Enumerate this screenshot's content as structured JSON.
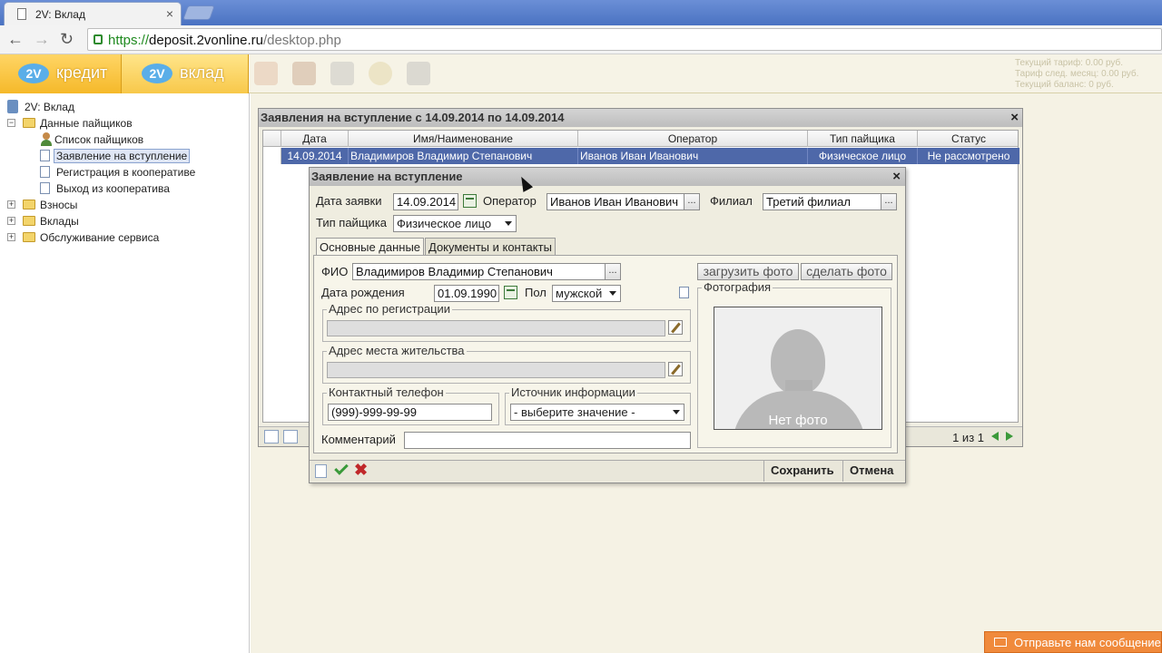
{
  "browser": {
    "tab_title": "2V: Вклад",
    "tab_close": "×",
    "url_scheme": "https://",
    "url_host": "deposit.2vonline.ru",
    "url_path": "/desktop.php",
    "back": "←",
    "forward": "→",
    "reload": "↻"
  },
  "header": {
    "brands": [
      {
        "logo": "2V",
        "label": "кредит"
      },
      {
        "logo": "2V",
        "label": "вклад"
      }
    ],
    "tariff_lines": [
      "Текущий тариф: 0.00 руб.",
      "Тариф след. месяц: 0.00 руб.",
      "Текущий баланс: 0 руб."
    ]
  },
  "sidebar": {
    "root": "2V: Вклад",
    "items": [
      {
        "label": "Данные пайщиков",
        "expander": "−"
      },
      {
        "label": "Список пайщиков"
      },
      {
        "label": "Заявление на вступление"
      },
      {
        "label": "Регистрация в кооперативе"
      },
      {
        "label": "Выход из кооператива"
      },
      {
        "label": "Взносы",
        "expander": "+"
      },
      {
        "label": "Вклады",
        "expander": "+"
      },
      {
        "label": "Обслуживание сервиса",
        "expander": "+"
      }
    ]
  },
  "list_window": {
    "title": "Заявления на вступление с 14.09.2014 по 14.09.2014",
    "close": "×",
    "columns": [
      "Дата",
      "Имя/Наименование",
      "Оператор",
      "Тип пайщика",
      "Статус"
    ],
    "rows": [
      [
        "14.09.2014",
        "Владимиров Владимир Степанович",
        "Иванов Иван Иванович",
        "Физическое лицо",
        "Не рассмотрено"
      ]
    ],
    "pager": "1 из 1"
  },
  "dialog": {
    "title": "Заявление на вступление",
    "close": "×",
    "date_label": "Дата заявки",
    "date_value": "14.09.2014",
    "operator_label": "Оператор",
    "operator_value": "Иванов Иван Иванович",
    "branch_label": "Филиал",
    "branch_value": "Третий филиал",
    "type_label": "Тип пайщика",
    "type_value": "Физическое лицо",
    "dots": "...",
    "tabs": [
      "Основные данные",
      "Документы и контакты"
    ],
    "fio_label": "ФИО",
    "fio_value": "Владимиров Владимир Степанович",
    "dob_label": "Дата рождения",
    "dob_value": "01.09.1990",
    "sex_label": "Пол",
    "sex_value": "мужской",
    "reg_address_legend": "Адрес по регистрации",
    "live_address_legend": "Адрес места жительства",
    "phone_legend": "Контактный телефон",
    "phone_value": "(999)-999-99-99",
    "source_legend": "Источник информации",
    "source_value": "- выберите значение -",
    "comment_label": "Комментарий",
    "upload_photo": "загрузить фото",
    "take_photo": "сделать фото",
    "photo_legend": "Фотография",
    "no_photo": "Нет фото",
    "save": "Сохранить",
    "cancel": "Отмена"
  },
  "feedback": "Отправьте нам сообщение"
}
